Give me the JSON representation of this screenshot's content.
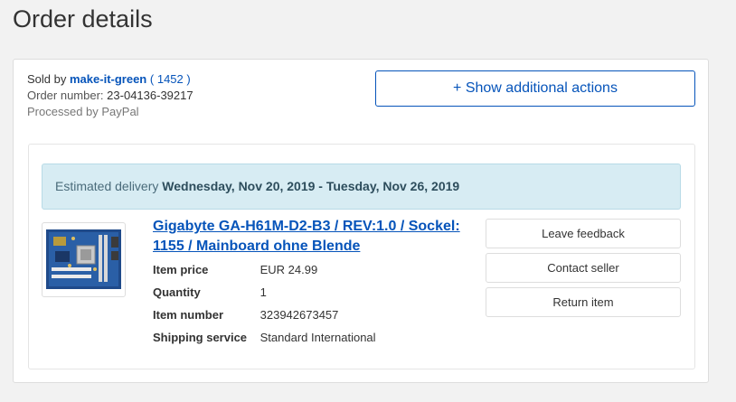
{
  "page": {
    "title": "Order details"
  },
  "seller": {
    "prefix": "Sold by",
    "name": "make-it-green",
    "feedback_open": "(",
    "feedback_score": "1452",
    "feedback_close": ")",
    "order_number_label": "Order number:",
    "order_number": "23-04136-39217",
    "processed": "Processed by PayPal"
  },
  "actions": {
    "show_more": "+ Show additional actions"
  },
  "delivery": {
    "label": "Estimated delivery",
    "dates": "Wednesday, Nov 20, 2019 - Tuesday, Nov 26, 2019"
  },
  "item": {
    "title": "Gigabyte GA-H61M-D2-B3 / REV:1.0 / Sockel: 1155 / Mainboard ohne Blende",
    "details": [
      {
        "label": "Item price",
        "value": "EUR 24.99"
      },
      {
        "label": "Quantity",
        "value": "1"
      },
      {
        "label": "Item number",
        "value": "323942673457"
      },
      {
        "label": "Shipping service",
        "value": "Standard International"
      }
    ],
    "image_icon": "motherboard-image",
    "buttons": {
      "leave_feedback": "Leave feedback",
      "contact_seller": "Contact seller",
      "return_item": "Return item"
    }
  },
  "colors": {
    "link": "#0654ba",
    "banner_bg": "#d7ecf3",
    "page_bg": "#f2f2f2"
  }
}
